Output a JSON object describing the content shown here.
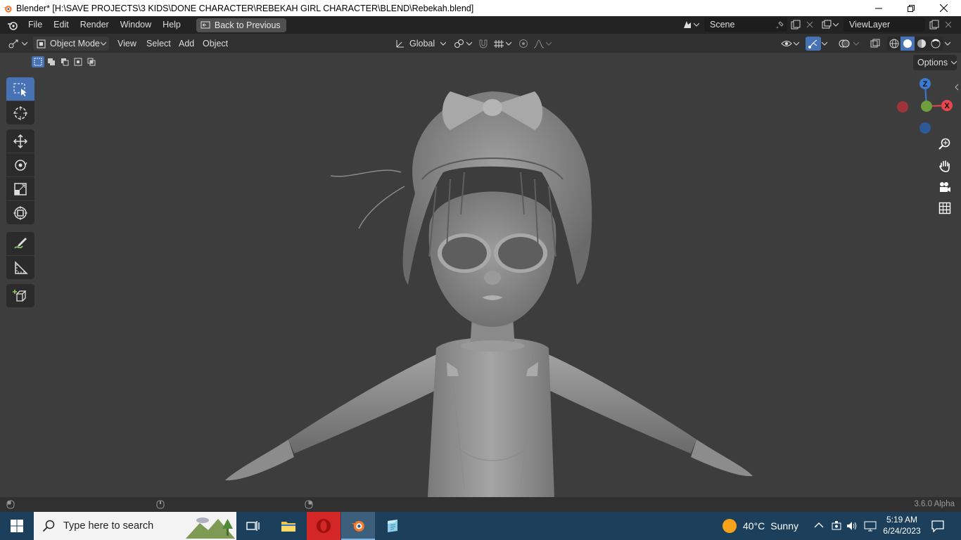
{
  "window": {
    "title": "Blender* [H:\\SAVE PROJECTS\\3 KIDS\\DONE CHARACTER\\REBEKAH GIRL CHARACTER\\BLEND\\Rebekah.blend]"
  },
  "topbar": {
    "menus": [
      "File",
      "Edit",
      "Render",
      "Window",
      "Help"
    ],
    "back_button": "Back to Previous",
    "scene": "Scene",
    "view_layer": "ViewLayer"
  },
  "header": {
    "mode": "Object Mode",
    "menus": [
      "View",
      "Select",
      "Add",
      "Object"
    ],
    "orientation": "Global",
    "options": "Options"
  },
  "gizmo": {
    "z": "Z",
    "x": "X"
  },
  "statusbar": {
    "version": "3.6.0 Alpha"
  },
  "taskbar": {
    "search_placeholder": "Type here to search",
    "weather_temp": "40°C",
    "weather_desc": "Sunny",
    "time": "5:19 AM",
    "date": "6/24/2023"
  },
  "colors": {
    "accent": "#4772b3",
    "axis_x": "#e8454c",
    "axis_y": "#8bc34a",
    "axis_z": "#3b7bd4",
    "taskbar": "#1c3f5b"
  }
}
